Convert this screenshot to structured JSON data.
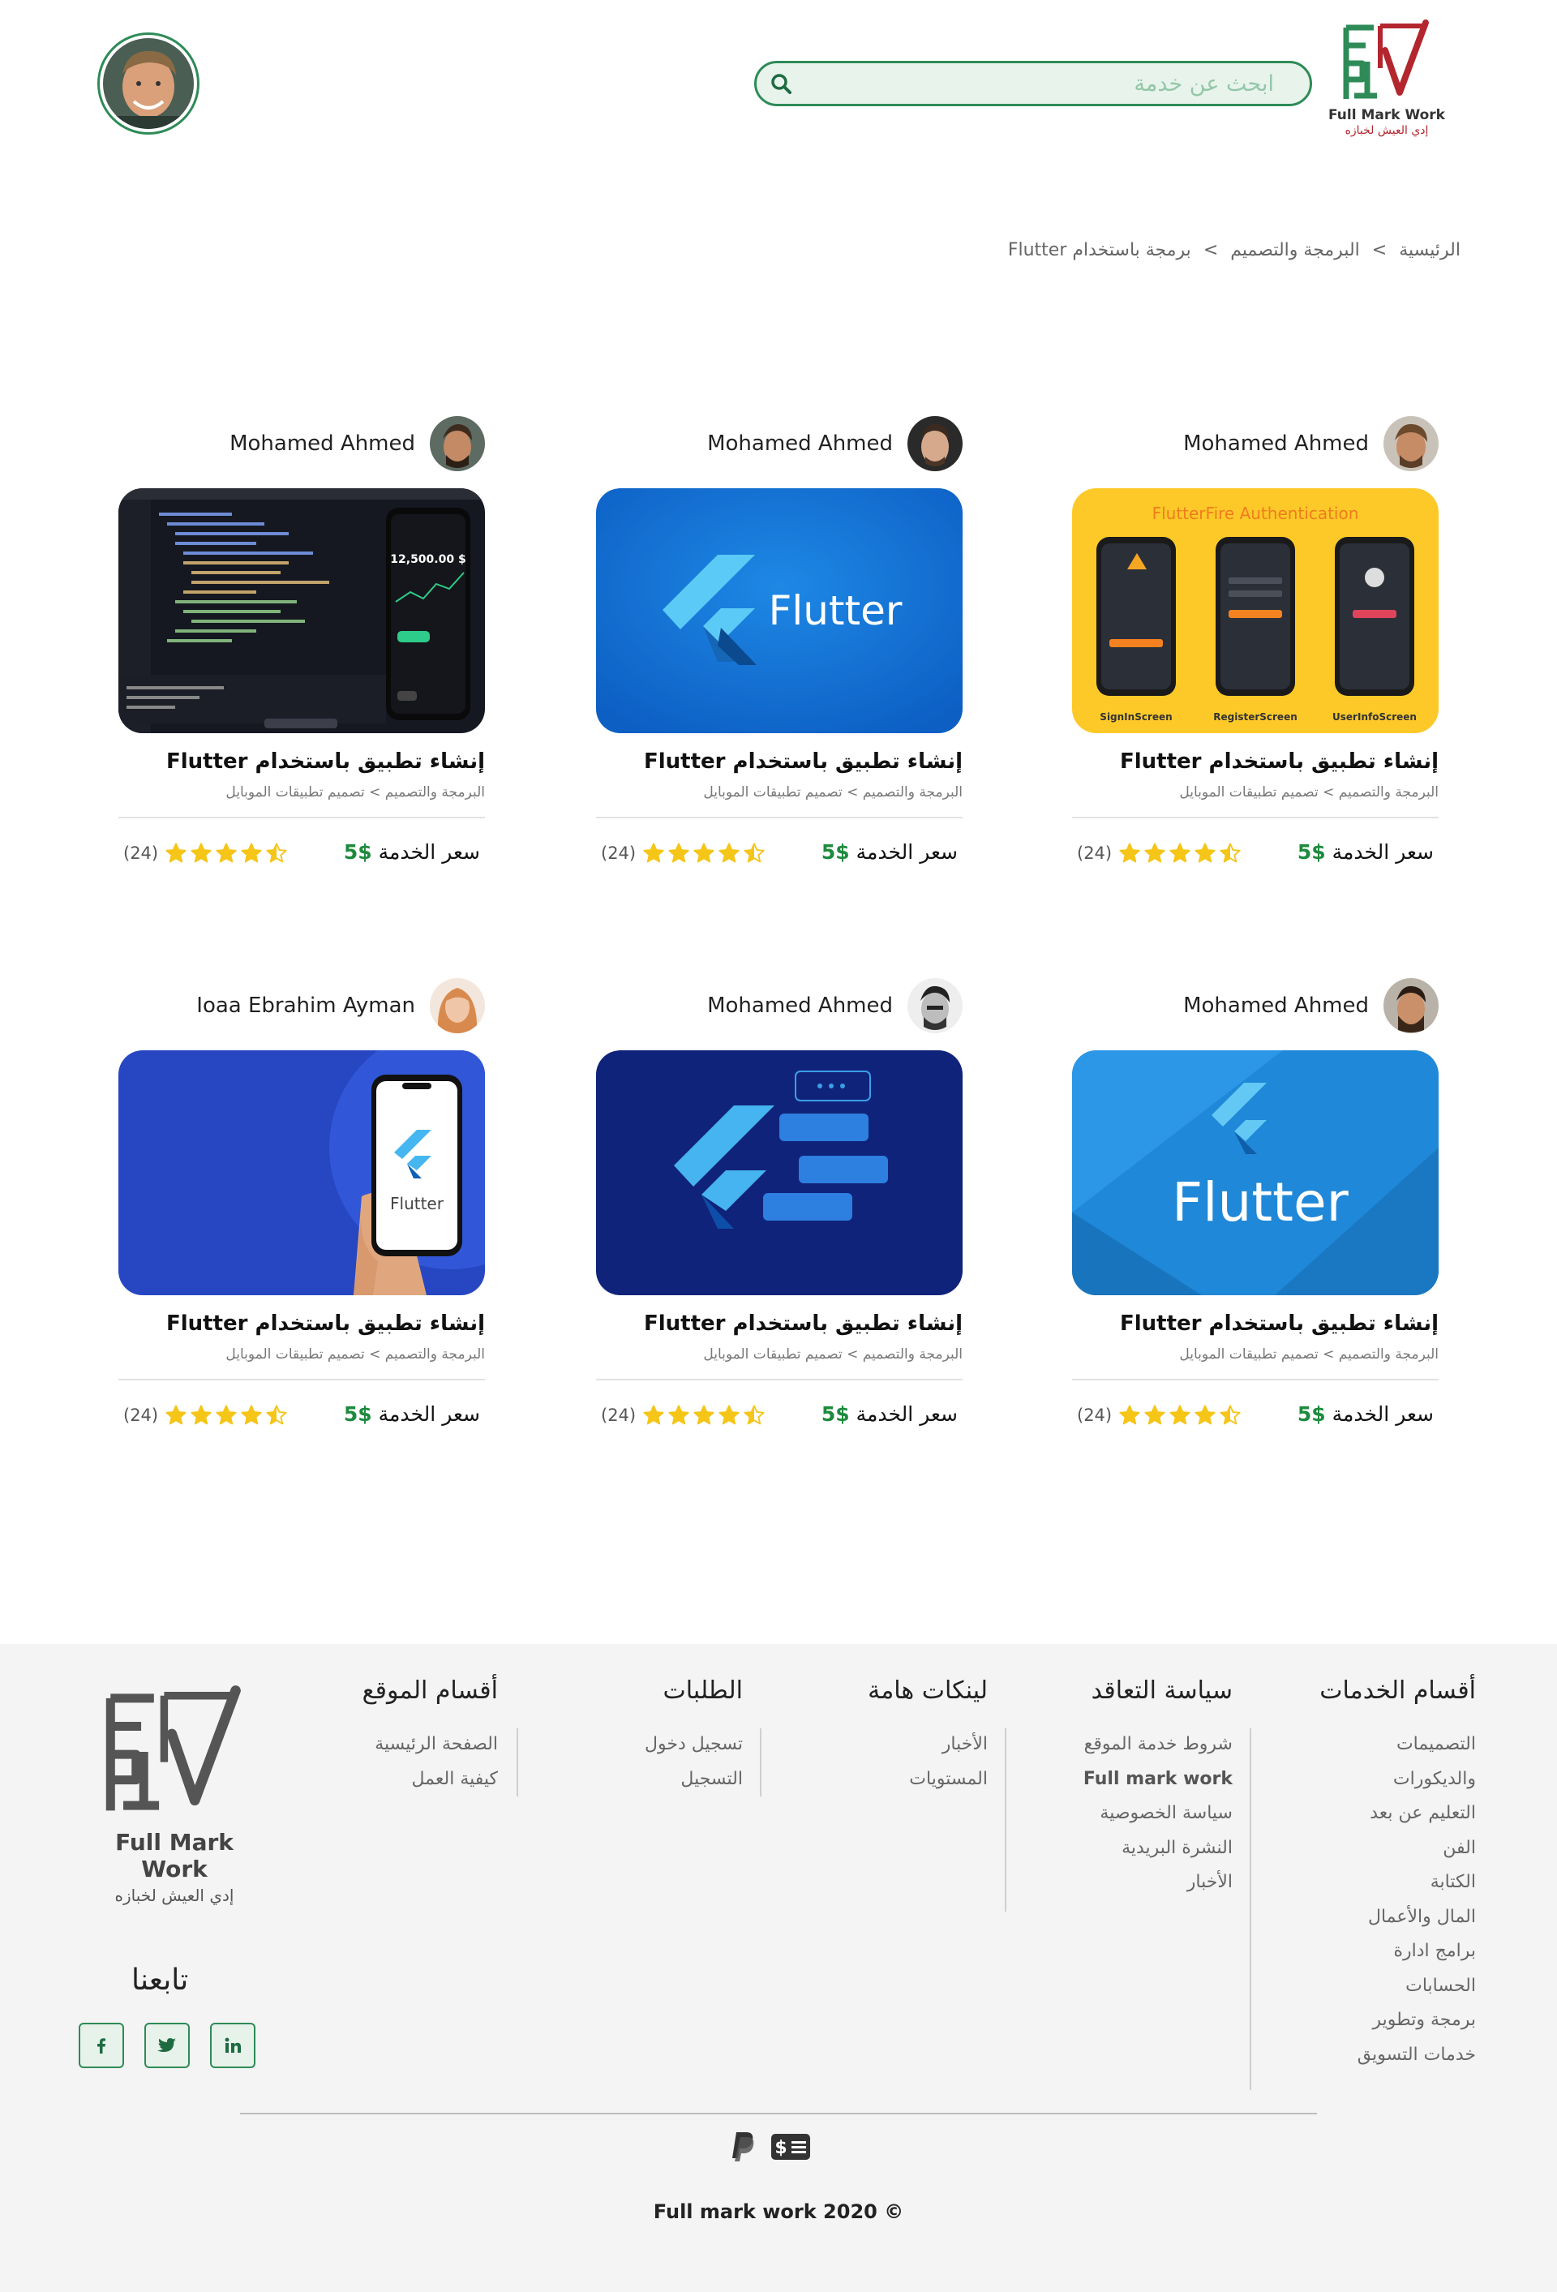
{
  "header": {
    "logo_text": "Full Mark Work",
    "logo_tagline": "إدي العيش لخبازه",
    "search_placeholder": "ابحث عن خدمة"
  },
  "breadcrumb": {
    "items": [
      "الرئيسية",
      "البرمجة والتصميم",
      "برمجة باستخدام Flutter"
    ],
    "separator": ">"
  },
  "services": [
    {
      "author": "Mohamed Ahmed",
      "image": "flutterfire-auth",
      "image_text": "FlutterFire Authentication",
      "screens": [
        "SignInScreen",
        "RegisterScreen",
        "UserInfoScreen"
      ],
      "title": "إنشاء تطبيق باستخدام Flutter",
      "category": "البرمجة والتصميم > تصميم تطبيقات الموبايل",
      "price_label": "سعر الخدمة",
      "price": "5$",
      "rating": 4.5,
      "reviews": "(24)"
    },
    {
      "author": "Mohamed Ahmed",
      "image": "flutter-blue-logo",
      "image_text": "Flutter",
      "title": "إنشاء تطبيق باستخدام Flutter",
      "category": "البرمجة والتصميم > تصميم تطبيقات الموبايل",
      "price_label": "سعر الخدمة",
      "price": "5$",
      "rating": 4.5,
      "reviews": "(24)"
    },
    {
      "author": "Mohamed Ahmed",
      "image": "code-editor-phone",
      "image_text": "$ 12,500.00",
      "title": "إنشاء تطبيق باستخدام Flutter",
      "category": "البرمجة والتصميم > تصميم تطبيقات الموبايل",
      "price_label": "سعر الخدمة",
      "price": "5$",
      "rating": 4.5,
      "reviews": "(24)"
    },
    {
      "author": "Mohamed Ahmed",
      "image": "flutter-light-blue",
      "image_text": "Flutter",
      "title": "إنشاء تطبيق باستخدام Flutter",
      "category": "البرمجة والتصميم > تصميم تطبيقات الموبايل",
      "price_label": "سعر الخدمة",
      "price": "5$",
      "rating": 4.5,
      "reviews": "(24)"
    },
    {
      "author": "Mohamed Ahmed",
      "image": "flutter-chat-dark",
      "title": "إنشاء تطبيق باستخدام Flutter",
      "category": "البرمجة والتصميم > تصميم تطبيقات الموبايل",
      "price_label": "سعر الخدمة",
      "price": "5$",
      "rating": 4.5,
      "reviews": "(24)"
    },
    {
      "author": "Ioaa Ebrahim Ayman",
      "image": "flutter-phone-hand",
      "image_text": "Flutter",
      "title": "إنشاء تطبيق باستخدام Flutter",
      "category": "البرمجة والتصميم > تصميم تطبيقات الموبايل",
      "price_label": "سعر الخدمة",
      "price": "5$",
      "rating": 4.5,
      "reviews": "(24)"
    }
  ],
  "footer": {
    "columns": [
      {
        "title": "أقسام الخدمات",
        "items": [
          "التصميمات",
          "والديكورات",
          "التعليم عن بعد",
          "الفن",
          "الكتابة",
          "المال والأعمال",
          "برامج ادارة",
          "الحسابات",
          "برمجة وتطوير",
          "خدمات التسويق"
        ]
      },
      {
        "title": "سياسة التعاقد",
        "items": [
          "شروط خدمة الموقع",
          "Full mark work",
          "سياسة الخصوصية",
          "النشرة البريدية",
          "الأخبار"
        ]
      },
      {
        "title": "لينكات هامة",
        "items": [
          "الأخبار",
          "المستويات"
        ]
      },
      {
        "title": "الطلبات",
        "items": [
          "تسجيل دخول",
          "التسجيل"
        ]
      },
      {
        "title": "أقسام الموقع",
        "items": [
          "الصفحة الرئيسية",
          "كيفية العمل"
        ]
      }
    ],
    "logo_text": "Full Mark Work",
    "logo_tagline": "إدي العيش لخبازه",
    "follow_label": "تابعنا",
    "social": [
      "facebook-icon",
      "twitter-icon",
      "linkedin-icon"
    ],
    "payment_icons": [
      "paypal-icon",
      "cash-icon"
    ],
    "copyright": "Full mark work 2020 ©"
  },
  "colors": {
    "brand_green": "#2e8b57",
    "brand_red": "#b3262e",
    "price_green": "#1e8a3e",
    "star": "#f5c518",
    "footer_bg": "#f4f4f4"
  }
}
